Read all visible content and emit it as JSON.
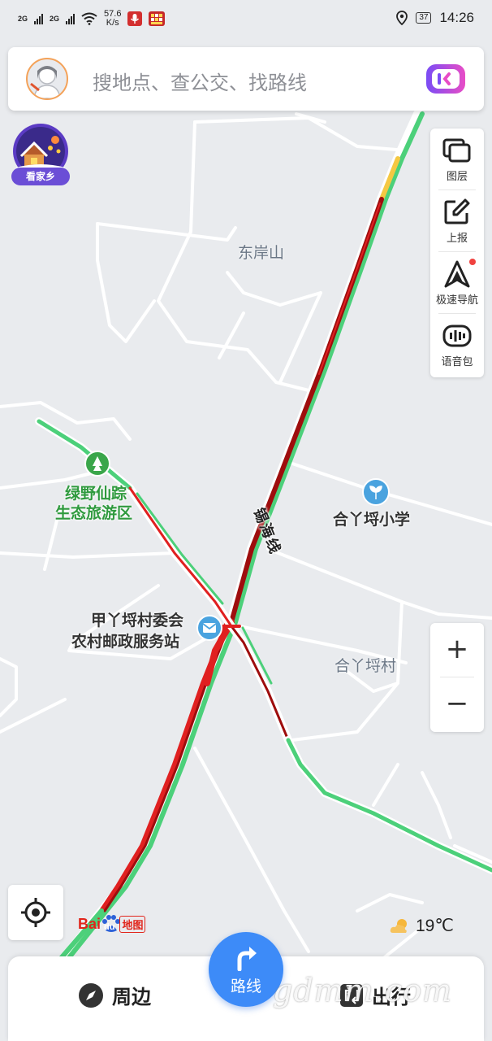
{
  "status_bar": {
    "sim1": "2G",
    "sim2": "2G",
    "speed_value": "57.6",
    "speed_unit": "K/s",
    "battery": "37",
    "time": "14:26"
  },
  "search": {
    "placeholder": "搜地点、查公交、找路线"
  },
  "home_badge": {
    "label": "看家乡"
  },
  "tools": [
    {
      "label": "图层",
      "icon": "layers-icon"
    },
    {
      "label": "上报",
      "icon": "report-edit-icon"
    },
    {
      "label": "极速导航",
      "icon": "navigation-arrow-icon"
    },
    {
      "label": "语音包",
      "icon": "voice-pack-icon"
    }
  ],
  "zoom": {
    "in": "+",
    "out": "−"
  },
  "map": {
    "road_label": "锡海线",
    "places": [
      {
        "name": "东岸山"
      },
      {
        "name": "合丫埒村"
      }
    ],
    "pois": [
      {
        "name_line1": "绿野仙踪",
        "name_line2": "生态旅游区",
        "color": "#3aa64a"
      },
      {
        "name": "合丫埒小学",
        "color": "#4aa3df"
      },
      {
        "name_line1": "甲丫埒村委会",
        "name_line2": "农村邮政服务站",
        "color": "#4aa3df"
      }
    ],
    "colors": {
      "smooth": "#4cd07a",
      "slow": "#f5c842",
      "congested": "#e02020",
      "severe": "#9e0d0d",
      "road": "#ffffff",
      "background": "#e9ebee"
    }
  },
  "logo": {
    "part1": "Bai",
    "part2": "du",
    "part3": "地图"
  },
  "weather": {
    "temp": "19℃",
    "icon": "partly-cloudy-icon"
  },
  "bottom_nav": {
    "nearby": "周边",
    "route": "路线",
    "travel": "出行"
  },
  "watermark": "gdmm.com"
}
